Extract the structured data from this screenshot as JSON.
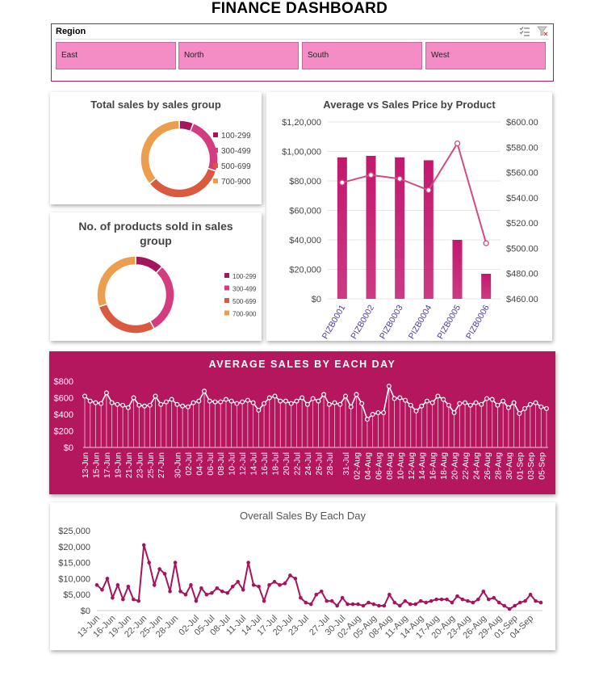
{
  "dashboard": {
    "title": "FINANCE DASHBOARD"
  },
  "slicer": {
    "header": "Region",
    "items": [
      "East",
      "North",
      "South",
      "West"
    ],
    "multi_select_icon": "multi-select-icon",
    "clear_filter_icon": "clear-filter-icon"
  },
  "colors": {
    "accent": "#b5175f",
    "slicer_item": "#f48cc6",
    "line": "#cc3d78",
    "bar": "#c2186e"
  },
  "chart_data": [
    {
      "type": "pie",
      "title": "Total sales by sales group",
      "categories": [
        "100-299",
        "300-499",
        "500-699",
        "700-900"
      ],
      "values": [
        6,
        24,
        34,
        36
      ],
      "colors": [
        "#a5155e",
        "#d43c80",
        "#d95a3e",
        "#eb9e4e"
      ],
      "legend": "right"
    },
    {
      "type": "pie",
      "title": "No. of products sold in sales group",
      "categories": [
        "100-299",
        "300-499",
        "500-699",
        "700-900"
      ],
      "values": [
        12,
        30,
        28,
        30
      ],
      "colors": [
        "#a5155e",
        "#d43c80",
        "#d95a3e",
        "#eb9e4e"
      ],
      "legend": "right"
    },
    {
      "type": "bar",
      "title": "Average vs Sales Price by Product",
      "categories": [
        "PIZB0001",
        "PIZB0002",
        "PIZB0003",
        "PIZB0004",
        "PIZB0005",
        "PIZB0006"
      ],
      "y_ticks": [
        "$0",
        "$20,000",
        "$40,000",
        "$60,000",
        "$80,000",
        "$1,00,000",
        "$1,20,000"
      ],
      "y2_ticks": [
        "$460.00",
        "$480.00",
        "$500.00",
        "$520.00",
        "$540.00",
        "$560.00",
        "$580.00",
        "$600.00"
      ],
      "ylim": [
        0,
        120000
      ],
      "y2lim": [
        460,
        600
      ],
      "series": [
        {
          "type": "bar",
          "axis": "left",
          "values": [
            96000,
            97000,
            96000,
            94000,
            40000,
            17000
          ]
        },
        {
          "type": "line",
          "axis": "right",
          "values": [
            552,
            558,
            555,
            546,
            583,
            504
          ]
        }
      ],
      "grid": true
    },
    {
      "type": "line",
      "title": "AVERAGE SALES BY EACH DAY",
      "categories": [
        "13-Jun",
        "14-Jun",
        "15-Jun",
        "16-Jun",
        "17-Jun",
        "18-Jun",
        "19-Jun",
        "20-Jun",
        "21-Jun",
        "22-Jun",
        "23-Jun",
        "24-Jun",
        "25-Jun",
        "26-Jun",
        "27-Jun",
        "28-Jun",
        "29-Jun",
        "30-Jun",
        "01-Jul",
        "02-Jul",
        "03-Jul",
        "04-Jul",
        "05-Jul",
        "06-Jul",
        "07-Jul",
        "08-Jul",
        "09-Jul",
        "10-Jul",
        "11-Jul",
        "12-Jul",
        "13-Jul",
        "14-Jul",
        "15-Jul",
        "16-Jul",
        "17-Jul",
        "18-Jul",
        "19-Jul",
        "20-Jul",
        "21-Jul",
        "22-Jul",
        "23-Jul",
        "24-Jul",
        "25-Jul",
        "26-Jul",
        "27-Jul",
        "28-Jul",
        "29-Jul",
        "30-Jul",
        "31-Jul",
        "01-Aug",
        "02-Aug",
        "03-Aug",
        "04-Aug",
        "05-Aug",
        "06-Aug",
        "07-Aug",
        "08-Aug",
        "09-Aug",
        "10-Aug",
        "11-Aug",
        "12-Aug",
        "13-Aug",
        "14-Aug",
        "15-Aug",
        "16-Aug",
        "17-Aug",
        "18-Aug",
        "19-Aug",
        "20-Aug",
        "21-Aug",
        "22-Aug",
        "23-Aug",
        "24-Aug",
        "25-Aug",
        "26-Aug",
        "27-Aug",
        "28-Aug",
        "29-Aug",
        "30-Aug",
        "31-Aug",
        "01-Sep",
        "02-Sep",
        "03-Sep",
        "04-Sep",
        "05-Sep",
        "06-Sep"
      ],
      "tick_labels": [
        "13-Jun",
        "15-Jun",
        "17-Jun",
        "19-Jun",
        "21-Jun",
        "23-Jun",
        "25-Jun",
        "27-Jun",
        "30-Jun",
        "02-Jul",
        "04-Jul",
        "06-Jul",
        "08-Jul",
        "10-Jul",
        "12-Jul",
        "14-Jul",
        "16-Jul",
        "18-Jul",
        "20-Jul",
        "22-Jul",
        "24-Jul",
        "26-Jul",
        "28-Jul",
        "31-Jul",
        "02-Aug",
        "04-Aug",
        "06-Aug",
        "08-Aug",
        "10-Aug",
        "12-Aug",
        "14-Aug",
        "16-Aug",
        "18-Aug",
        "20-Aug",
        "22-Aug",
        "24-Aug",
        "26-Aug",
        "28-Aug",
        "30-Aug",
        "01-Sep",
        "03-Sep",
        "05-Sep"
      ],
      "values": [
        620,
        560,
        540,
        530,
        660,
        540,
        520,
        510,
        480,
        600,
        510,
        500,
        510,
        620,
        520,
        550,
        580,
        520,
        500,
        490,
        540,
        560,
        680,
        560,
        550,
        550,
        580,
        560,
        530,
        550,
        570,
        540,
        450,
        530,
        600,
        620,
        560,
        560,
        530,
        560,
        600,
        520,
        590,
        560,
        640,
        520,
        540,
        520,
        620,
        490,
        640,
        530,
        340,
        400,
        420,
        420,
        740,
        590,
        600,
        570,
        510,
        440,
        500,
        560,
        540,
        620,
        580,
        510,
        420,
        530,
        540,
        510,
        540,
        520,
        590,
        580,
        510,
        560,
        480,
        540,
        410,
        470,
        520,
        540,
        490,
        470
      ],
      "y_ticks": [
        "$0",
        "$200",
        "$400",
        "$600",
        "$800"
      ],
      "ylim": [
        0,
        800
      ],
      "grid": false
    },
    {
      "type": "line",
      "title": "Overall Sales By Each Day",
      "categories": [
        "13-Jun",
        "14-Jun",
        "15-Jun",
        "16-Jun",
        "17-Jun",
        "18-Jun",
        "19-Jun",
        "20-Jun",
        "21-Jun",
        "22-Jun",
        "23-Jun",
        "24-Jun",
        "25-Jun",
        "26-Jun",
        "27-Jun",
        "28-Jun",
        "29-Jun",
        "30-Jun",
        "01-Jul",
        "02-Jul",
        "03-Jul",
        "04-Jul",
        "05-Jul",
        "06-Jul",
        "07-Jul",
        "08-Jul",
        "09-Jul",
        "10-Jul",
        "11-Jul",
        "12-Jul",
        "13-Jul",
        "14-Jul",
        "15-Jul",
        "16-Jul",
        "17-Jul",
        "18-Jul",
        "19-Jul",
        "20-Jul",
        "21-Jul",
        "22-Jul",
        "23-Jul",
        "24-Jul",
        "25-Jul",
        "26-Jul",
        "27-Jul",
        "28-Jul",
        "29-Jul",
        "30-Jul",
        "31-Jul",
        "01-Aug",
        "02-Aug",
        "03-Aug",
        "04-Aug",
        "05-Aug",
        "06-Aug",
        "07-Aug",
        "08-Aug",
        "09-Aug",
        "10-Aug",
        "11-Aug",
        "12-Aug",
        "13-Aug",
        "14-Aug",
        "15-Aug",
        "16-Aug",
        "17-Aug",
        "18-Aug",
        "19-Aug",
        "20-Aug",
        "21-Aug",
        "22-Aug",
        "23-Aug",
        "24-Aug",
        "25-Aug",
        "26-Aug",
        "27-Aug",
        "28-Aug",
        "29-Aug",
        "30-Aug",
        "31-Aug",
        "01-Sep",
        "02-Sep",
        "03-Sep",
        "04-Sep",
        "05-Sep",
        "06-Sep"
      ],
      "tick_labels": [
        "13-Jun",
        "16-Jun",
        "19-Jun",
        "22-Jun",
        "25-Jun",
        "28-Jun",
        "02-Jul",
        "05-Jul",
        "08-Jul",
        "11-Jul",
        "14-Jul",
        "17-Jul",
        "20-Jul",
        "23-Jul",
        "27-Jul",
        "30-Jul",
        "02-Aug",
        "05-Aug",
        "08-Aug",
        "11-Aug",
        "14-Aug",
        "17-Aug",
        "20-Aug",
        "23-Aug",
        "26-Aug",
        "29-Aug",
        "01-Sep",
        "04-Sep"
      ],
      "values": [
        8000,
        6500,
        10000,
        4000,
        8000,
        3500,
        7500,
        3500,
        3000,
        20500,
        15000,
        8000,
        13000,
        11500,
        6000,
        15000,
        6000,
        5000,
        8000,
        3000,
        7000,
        5000,
        5500,
        7000,
        6000,
        5500,
        7500,
        9000,
        6500,
        15000,
        8000,
        7500,
        3000,
        8000,
        9000,
        8000,
        8500,
        11000,
        10000,
        4000,
        2500,
        2000,
        5000,
        6000,
        3000,
        3000,
        1500,
        4000,
        2000,
        2000,
        2000,
        1500,
        2500,
        2000,
        1500,
        1500,
        5000,
        2500,
        1500,
        3000,
        2000,
        2000,
        3000,
        2500,
        3000,
        3500,
        3500,
        3500,
        2500,
        4500,
        3500,
        3000,
        2500,
        3500,
        6000,
        3500,
        4000,
        2500,
        1500,
        500,
        1500,
        2500,
        3000,
        5000,
        3000,
        2500
      ],
      "y_ticks": [
        "$0",
        "$5,000",
        "$10,000",
        "$15,000",
        "$20,000",
        "$25,000"
      ],
      "ylim": [
        0,
        25000
      ],
      "grid": false
    }
  ]
}
